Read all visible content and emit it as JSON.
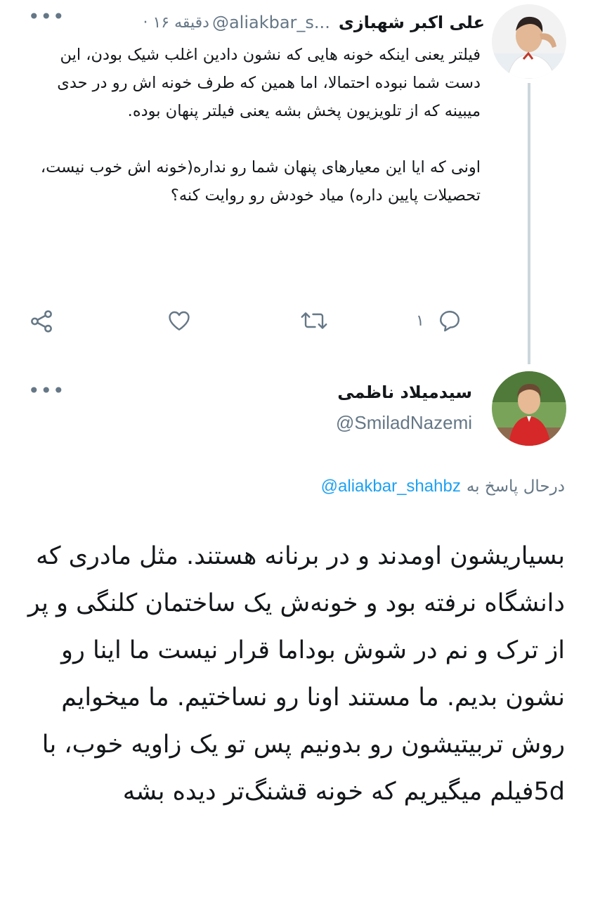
{
  "tweet1": {
    "author_name": "علی اکبر شهبازی",
    "handle": "@aliakbar_s...",
    "time": "· ۱۶ دقیقه",
    "paragraph1": "فیلتر یعنی اینکه خونه هایی که نشون دادین اغلب شیک بودن، این دست شما نبوده احتمالا، اما همین که طرف خونه اش رو در حدی میبینه که از تلویزیون پخش بشه یعنی فیلتر پنهان بوده.",
    "paragraph2": "اونی که ایا این معیارهای پنهان شما رو نداره(خونه اش خوب نیست، تحصیلات پایین داره) میاد خودش رو روایت کنه؟",
    "reply_count": "۱",
    "more_icon": "ellipsis-icon",
    "icons": [
      "reply-icon",
      "retweet-icon",
      "like-icon",
      "share-icon"
    ]
  },
  "tweet2": {
    "author_name": "سیدمیلاد ناظمی",
    "handle": "@SmiladNazemi",
    "reply_prefix": "درحال پاسخ به",
    "reply_to": "@aliakbar_shahbz",
    "text": "بسیاریشون اومدند و در برنانه هستند. مثل مادری که دانشگاه نرفته بود و خونه‌ش یک ساختمان کلنگی و پر از ترک و نم در شوش بوداما قرار نیست ما اینا رو نشون بدیم. ما مستند اونا رو نساختیم. ما میخوایم روش تربیتیشون رو بدونیم پس تو یک زاویه خوب، با 5dفیلم میگیریم که خونه قشنگ‌تر دیده بشه"
  },
  "colors": {
    "link": "#1da1f2",
    "muted": "#657786",
    "text": "#14171a",
    "line": "#ccd6dd"
  }
}
